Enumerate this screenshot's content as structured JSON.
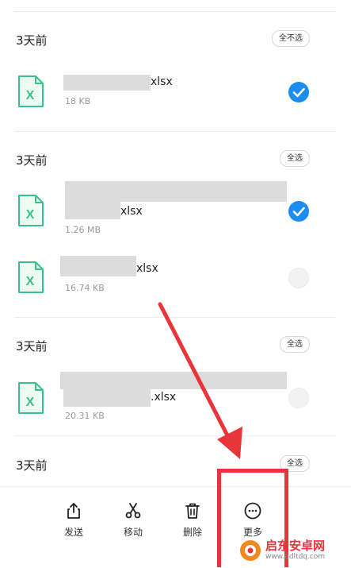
{
  "groups": [
    {
      "title": "3天前",
      "select_label": "全不选"
    },
    {
      "title": "3天前",
      "select_label": "全选"
    },
    {
      "title": "3天前",
      "select_label": "全选"
    },
    {
      "title": "3天前",
      "select_label": "全选"
    }
  ],
  "files": [
    {
      "name_suffix": "xlsx",
      "size": "18 KB",
      "checked": true
    },
    {
      "name_suffix": "xlsx",
      "size": "1.26 MB",
      "checked": true
    },
    {
      "name_suffix": "xlsx",
      "size": "16.74 KB",
      "checked": false
    },
    {
      "name_suffix": ".xlsx",
      "size": "20.31 KB",
      "checked": false
    }
  ],
  "file_icon_letter": "X",
  "toolbar": {
    "send": "发送",
    "move": "移动",
    "delete": "删除",
    "more": "更多"
  },
  "watermark": {
    "brand": "启东安卓网",
    "url": "www.qdltdq.com"
  },
  "colors": {
    "accent": "#1c8df0",
    "annotation": "#e8353b",
    "file_icon": "#3cc08a"
  }
}
